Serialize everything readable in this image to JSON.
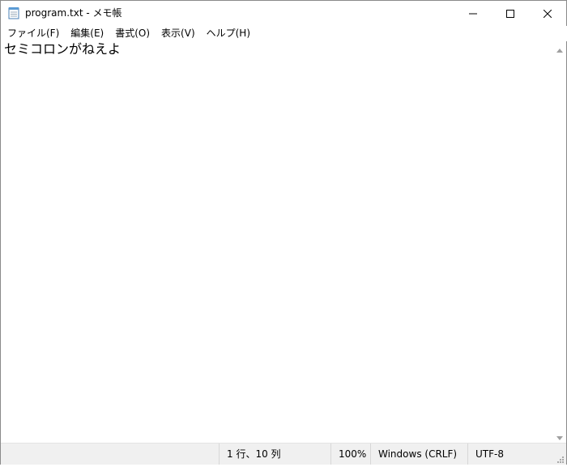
{
  "window": {
    "title": "program.txt - メモ帳"
  },
  "menu": {
    "items": [
      {
        "label": "ファイル(F)"
      },
      {
        "label": "編集(E)"
      },
      {
        "label": "書式(O)"
      },
      {
        "label": "表示(V)"
      },
      {
        "label": "ヘルプ(H)"
      }
    ]
  },
  "editor": {
    "content": "セミコロンがねえよ"
  },
  "status": {
    "position": "1 行、10 列",
    "zoom": "100%",
    "line_ending": "Windows (CRLF)",
    "encoding": "UTF-8"
  },
  "icons": {
    "app": "notepad-icon",
    "minimize": "minimize-icon",
    "maximize": "maximize-icon",
    "close": "close-icon",
    "scroll_up": "scroll-up-arrow-icon",
    "scroll_down": "scroll-down-arrow-icon",
    "grip": "resize-grip-icon"
  }
}
